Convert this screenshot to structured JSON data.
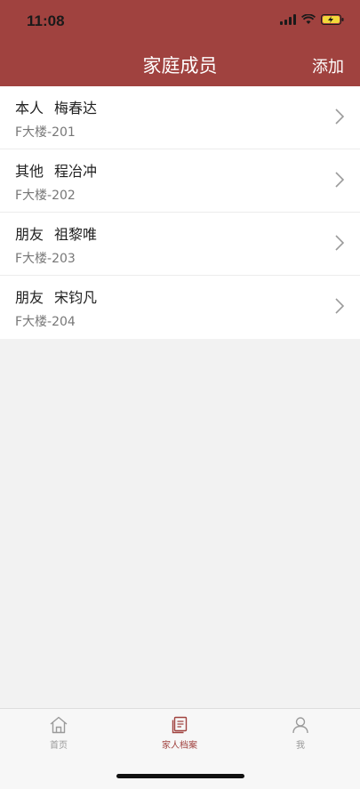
{
  "status_bar": {
    "time": "11:08"
  },
  "nav": {
    "title": "家庭成员",
    "action": "添加"
  },
  "members": [
    {
      "relation": "本人",
      "name": "梅春达",
      "address": "F大楼-201"
    },
    {
      "relation": "其他",
      "name": "程冶冲",
      "address": "F大楼-202"
    },
    {
      "relation": "朋友",
      "name": "祖黎唯",
      "address": "F大楼-203"
    },
    {
      "relation": "朋友",
      "name": "宋钧凡",
      "address": "F大楼-204"
    }
  ],
  "tabbar": {
    "tabs": [
      {
        "label": "首页",
        "icon": "home-icon",
        "active": false
      },
      {
        "label": "家人档案",
        "icon": "document-icon",
        "active": true
      },
      {
        "label": "我",
        "icon": "user-icon",
        "active": false
      }
    ]
  },
  "colors": {
    "brand": "#a0423f",
    "background": "#f2f2f2"
  }
}
